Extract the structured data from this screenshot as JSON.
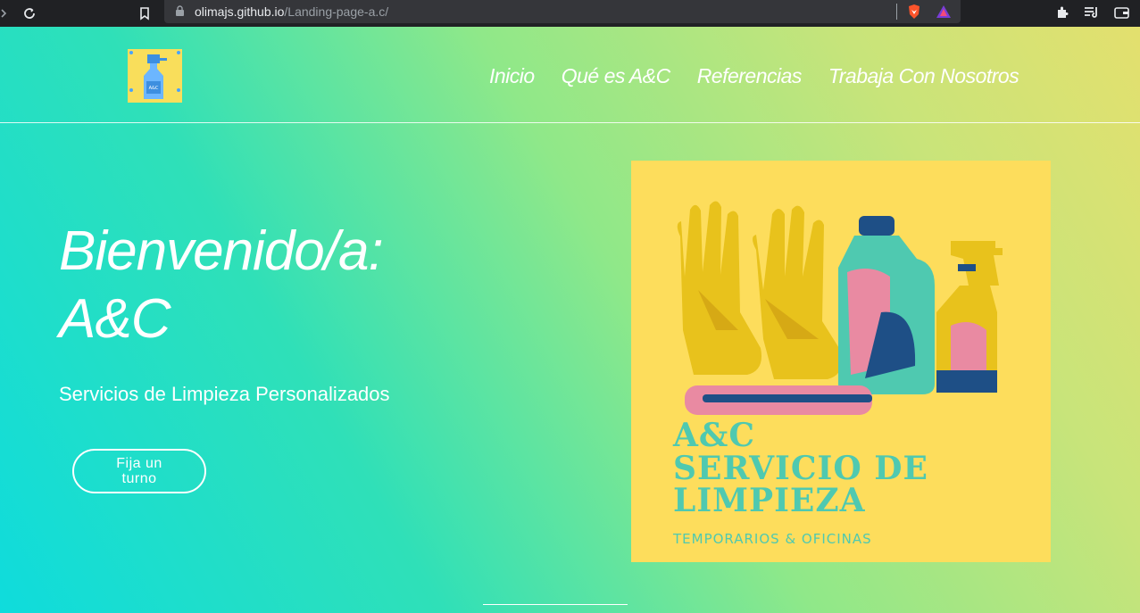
{
  "browser": {
    "url_host": "olimajs.github.io",
    "url_path": "/Landing-page-a.c/"
  },
  "nav": {
    "items": [
      "Inicio",
      "Qué es A&C",
      "Referencias",
      "Trabaja Con Nosotros"
    ]
  },
  "hero": {
    "title_line1": "Bienvenido/a:",
    "title_line2": "A&C",
    "subtitle": "Servicios de Limpieza Personalizados",
    "cta_label": "Fija un turno"
  },
  "promo": {
    "line1": "A&C",
    "line2": "SERVICIO DE LIMPIEZA",
    "line3": "TEMPORARIOS & OFICINAS"
  },
  "logo": {
    "label": "A&C"
  },
  "colors": {
    "gradient_start": "#0fdcdc",
    "gradient_end": "#e3e06e",
    "promo_bg": "#fddd5c",
    "promo_text": "#4fc9b0"
  }
}
